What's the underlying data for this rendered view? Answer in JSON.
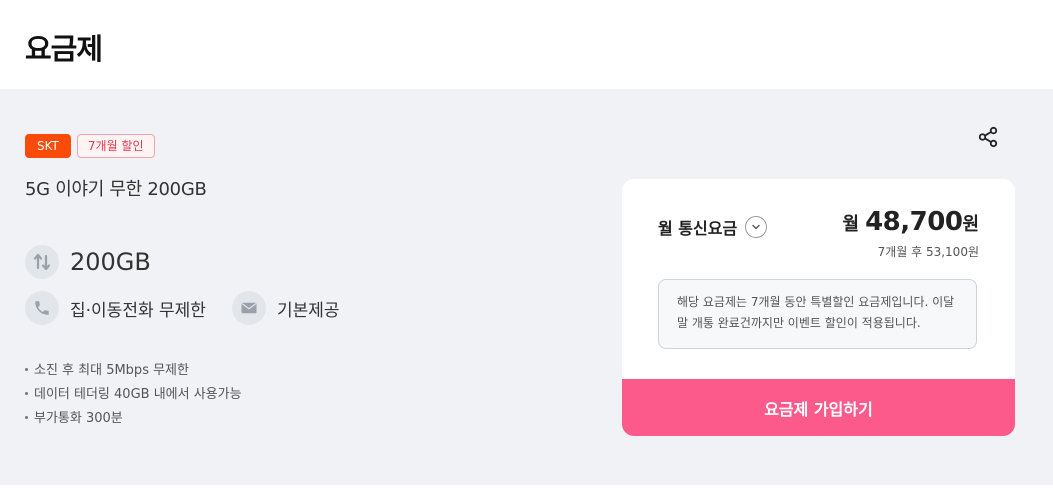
{
  "header": {
    "title": "요금제"
  },
  "plan": {
    "carrier_badge": "SKT",
    "discount_badge": "7개월 할인",
    "name": "5G 이야기 무한 200GB",
    "features": {
      "data": "200GB",
      "call": "집·이동전화 무제한",
      "sms": "기본제공"
    },
    "notes": [
      "소진 후 최대 5Mbps 무제한",
      "데이터 테더링 40GB 내에서 사용가능",
      "부가통화 300분"
    ]
  },
  "icons": {
    "share": "share-icon",
    "data": "data-transfer-icon",
    "call": "phone-icon",
    "sms": "mail-icon",
    "toggle": "chevron-down-icon"
  },
  "card": {
    "fee_label": "월 통신요금",
    "price_prefix": "월",
    "price_amount": "48,700",
    "price_unit": "원",
    "price_after": "7개월 후 53,100원",
    "info": "해당 요금제는 7개월 동안 특별할인 요금제입니다. 이달말 개통 완료건까지만 이벤트 할인이 적용됩니다.",
    "signup_button": "요금제 가입하기"
  },
  "colors": {
    "carrier_badge": "#fa4b0a",
    "discount_badge": "#e13a4a",
    "signup_button": "#fd5a8c",
    "panel_bg": "#f1f2f6"
  }
}
